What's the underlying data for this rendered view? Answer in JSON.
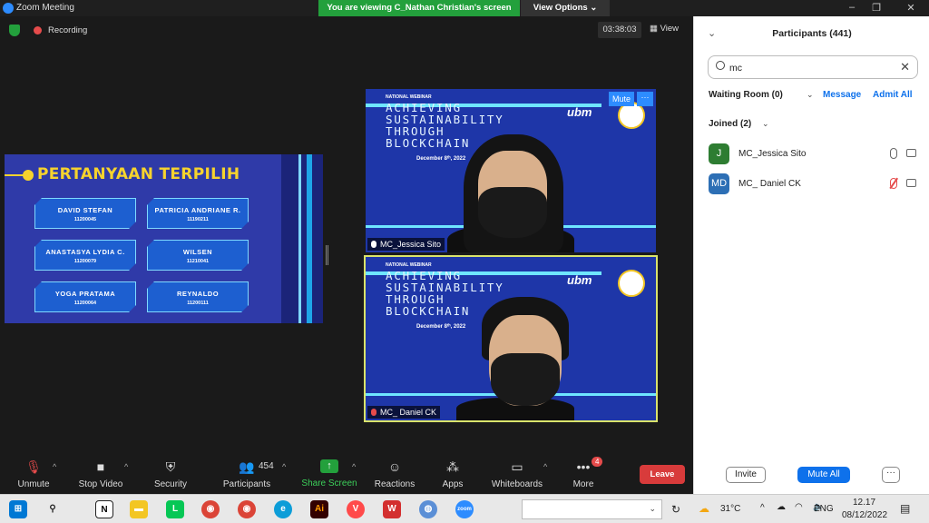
{
  "window": {
    "title": "Zoom Meeting",
    "viewing_banner": "You are viewing C_Nathan Christian's screen",
    "view_options": "View Options",
    "controls": [
      "–",
      "❐",
      "✕"
    ]
  },
  "meeting": {
    "recording_label": "Recording",
    "timer": "03:38:03",
    "view_label": "View"
  },
  "slide": {
    "headline": "PERTANYAAN TERPILIH",
    "cards": [
      {
        "name": "DAVID STEFAN",
        "id": "11200045"
      },
      {
        "name": "PATRICIA ANDRIANE R.",
        "id": "11190211"
      },
      {
        "name": "ANASTASYA LYDIA C.",
        "id": "11200079"
      },
      {
        "name": "WILSEN",
        "id": "11210041"
      },
      {
        "name": "YOGA PRATAMA",
        "id": "11200064"
      },
      {
        "name": "REYNALDO",
        "id": "11200111"
      }
    ]
  },
  "tiles": [
    {
      "subtitle": "NATIONAL WEBINAR",
      "title_lines": [
        "ACHIEVING",
        "SUSTAINABILITY",
        "THROUGH",
        "BLOCKCHAIN"
      ],
      "date": "December 8ᵗʰ, 2022",
      "logo": "ubm",
      "name": "MC_Jessica Sito",
      "muted": false
    },
    {
      "subtitle": "NATIONAL WEBINAR",
      "title_lines": [
        "ACHIEVING",
        "SUSTAINABILITY",
        "THROUGH",
        "BLOCKCHAIN"
      ],
      "date": "December 8ᵗʰ, 2022",
      "logo": "ubm",
      "name": "MC_ Daniel CK",
      "muted": true
    }
  ],
  "tile_controls": {
    "mute": "Mute",
    "more": "···"
  },
  "toolbar": {
    "unmute": "Unmute",
    "stop_video": "Stop Video",
    "security": "Security",
    "participants": "Participants",
    "participants_count": "454",
    "share_screen": "Share Screen",
    "reactions": "Reactions",
    "apps": "Apps",
    "whiteboards": "Whiteboards",
    "more": "More",
    "more_badge": "4",
    "leave": "Leave",
    "caret": "^"
  },
  "panel": {
    "title": "Participants (441)",
    "search_value": "mc",
    "waiting_room": "Waiting Room (0)",
    "message": "Message",
    "admit_all": "Admit All",
    "joined": "Joined (2)",
    "participants": [
      {
        "initials": "J",
        "name": "MC_Jessica Sito",
        "avatar_color": "#2e7d32",
        "muted": false
      },
      {
        "initials": "MD",
        "name": "MC_ Daniel CK",
        "avatar_color": "#2d6fb5",
        "muted": true
      }
    ],
    "invite": "Invite",
    "mute_all": "Mute All",
    "more": "···"
  },
  "taskbar": {
    "weather": "31°C",
    "lang": "ENG",
    "time": "12.17",
    "date": "08/12/2022"
  },
  "colors": {
    "accent": "#2d8cff",
    "green": "#23a03c",
    "leave": "#d83b3b",
    "slide_bg": "#2f3aa8",
    "tile_bg": "#1e36a8"
  }
}
